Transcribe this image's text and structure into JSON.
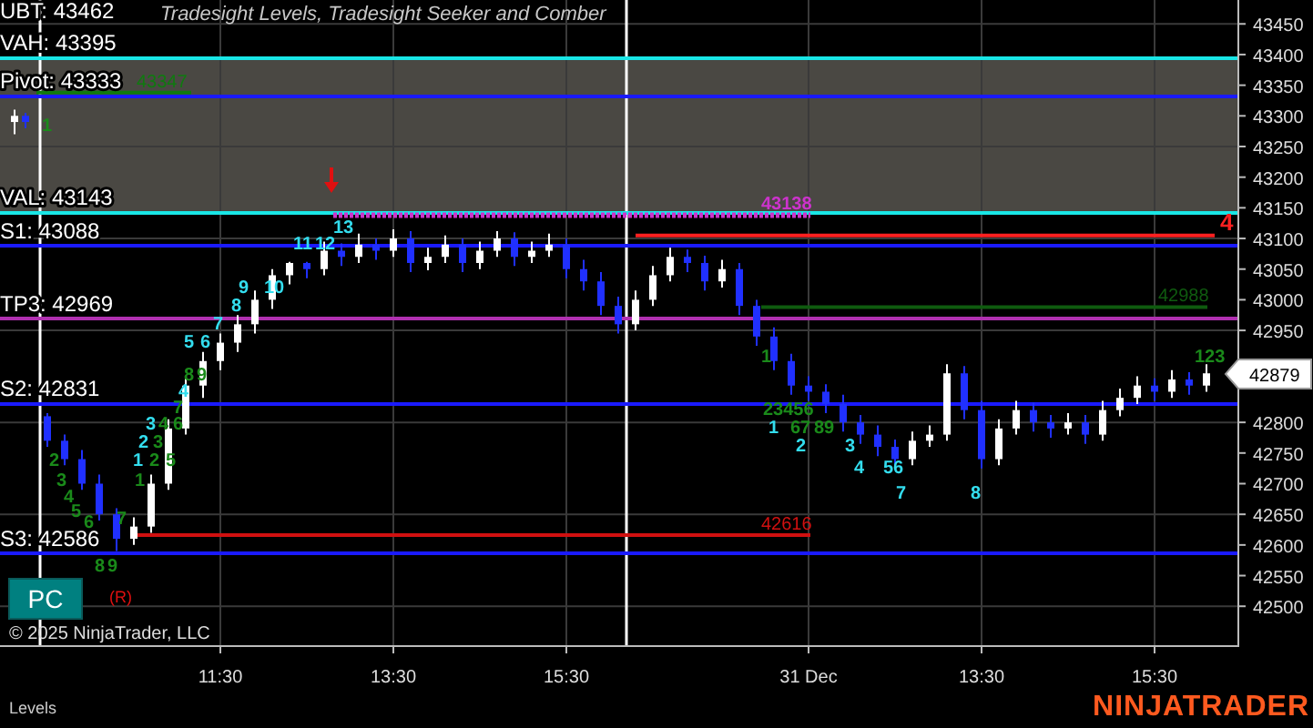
{
  "chart": {
    "legend": "Tradesight Levels, Tradesight Seeker and Comber",
    "header_label": "UBT: 43462",
    "markers": [
      {
        "label": "43347",
        "color": "#0f7a0f",
        "kind": "solid"
      },
      {
        "label": "43138",
        "color": "#cc33cc",
        "kind": "dashed"
      },
      {
        "label": "42988",
        "color": "#0f5a0f",
        "kind": "solid"
      },
      {
        "label": "42616",
        "color": "#d01010",
        "kind": "solid"
      },
      {
        "label": "4",
        "color": "#ff2020",
        "kind": "solid"
      }
    ],
    "counts_first_session": [
      {
        "text": "1",
        "color": "#1a8a1a"
      },
      {
        "text": "13",
        "color": "#33ddee"
      },
      {
        "text": "11",
        "color": "#33ddee"
      },
      {
        "text": "12",
        "color": "#33ddee"
      },
      {
        "text": "9",
        "color": "#33ddee"
      },
      {
        "text": "10",
        "color": "#33ddee"
      },
      {
        "text": "8",
        "color": "#33ddee"
      },
      {
        "text": "7",
        "color": "#33ddee"
      },
      {
        "text": "5",
        "color": "#33ddee"
      },
      {
        "text": "6",
        "color": "#33ddee"
      },
      {
        "text": "8",
        "color": "#1a8a1a"
      },
      {
        "text": "9",
        "color": "#1a8a1a"
      },
      {
        "text": "4",
        "color": "#33ddee"
      },
      {
        "text": "7",
        "color": "#1a8a1a"
      },
      {
        "text": "3",
        "color": "#33ddee"
      },
      {
        "text": "4",
        "color": "#1a8a1a"
      },
      {
        "text": "6",
        "color": "#1a8a1a"
      },
      {
        "text": "2",
        "color": "#33ddee"
      },
      {
        "text": "3",
        "color": "#1a8a1a"
      },
      {
        "text": "2",
        "color": "#1a8a1a"
      },
      {
        "text": "1",
        "color": "#33ddee"
      },
      {
        "text": "2",
        "color": "#1a8a1a"
      },
      {
        "text": "5",
        "color": "#1a8a1a"
      },
      {
        "text": "3",
        "color": "#1a8a1a"
      },
      {
        "text": "1",
        "color": "#1a8a1a"
      },
      {
        "text": "4",
        "color": "#1a8a1a"
      },
      {
        "text": "5",
        "color": "#1a8a1a"
      },
      {
        "text": "6",
        "color": "#1a8a1a"
      },
      {
        "text": "7",
        "color": "#1a8a1a"
      },
      {
        "text": "8",
        "color": "#1a8a1a"
      },
      {
        "text": "9",
        "color": "#1a8a1a"
      }
    ],
    "counts_second_session": [
      {
        "text": "1",
        "color": "#1a8a1a"
      },
      {
        "text": "123",
        "color": "#1a8a1a"
      },
      {
        "text": "23456",
        "color": "#1a8a1a"
      },
      {
        "text": "1",
        "color": "#33ddee"
      },
      {
        "text": "67",
        "color": "#1a8a1a"
      },
      {
        "text": "89",
        "color": "#1a8a1a"
      },
      {
        "text": "2",
        "color": "#33ddee"
      },
      {
        "text": "3",
        "color": "#33ddee"
      },
      {
        "text": "4",
        "color": "#33ddee"
      },
      {
        "text": "56",
        "color": "#33ddee"
      },
      {
        "text": "7",
        "color": "#33ddee"
      },
      {
        "text": "8",
        "color": "#33ddee"
      }
    ],
    "levels": [
      {
        "label": "VAH: 43395",
        "color": "#19e6e6"
      },
      {
        "label": "Pivot: 43333",
        "color": "#1a1aff"
      },
      {
        "label": "VAL: 43143",
        "color": "#19e6e6"
      },
      {
        "label": "S1: 43088",
        "color": "#1a1aff"
      },
      {
        "label": "TP3: 42969",
        "color": "#b030b0"
      },
      {
        "label": "S2: 42831",
        "color": "#1a1aff"
      },
      {
        "label": "S3: 42586",
        "color": "#1a1aff"
      }
    ],
    "chart_data": {
      "type": "candlestick",
      "grid": true,
      "categories": [
        null,
        null,
        null,
        null,
        null,
        null,
        null,
        null,
        null,
        null,
        null,
        null,
        "11:30",
        null,
        null,
        null,
        null,
        null,
        null,
        null,
        null,
        null,
        "13:30",
        null,
        null,
        null,
        null,
        null,
        null,
        null,
        null,
        null,
        "15:30",
        null,
        null,
        null,
        null,
        null,
        null,
        null,
        null,
        null,
        null,
        null,
        null,
        null,
        "31 Dec",
        null,
        null,
        null,
        null,
        null,
        null,
        null,
        null,
        null,
        "13:30",
        null,
        null,
        null,
        null,
        null,
        null,
        null,
        null,
        null,
        "15:30",
        null,
        null,
        null
      ],
      "ohlc": [
        [
          43290,
          43310,
          43270,
          43300
        ],
        [
          43300,
          43305,
          43280,
          43290
        ],
        [
          42810,
          42815,
          42760,
          42770
        ],
        [
          42770,
          42780,
          42730,
          42740
        ],
        [
          42740,
          42755,
          42690,
          42700
        ],
        [
          42700,
          42715,
          42640,
          42650
        ],
        [
          42650,
          42660,
          42590,
          42610
        ],
        [
          42610,
          42645,
          42600,
          42630
        ],
        [
          42630,
          42715,
          42620,
          42700
        ],
        [
          42700,
          42805,
          42690,
          42790
        ],
        [
          42790,
          42875,
          42780,
          42860
        ],
        [
          42860,
          42915,
          42840,
          42900
        ],
        [
          42900,
          42945,
          42885,
          42930
        ],
        [
          42930,
          42975,
          42915,
          42960
        ],
        [
          42960,
          43015,
          42945,
          43000
        ],
        [
          43000,
          43050,
          42985,
          43040
        ],
        [
          43040,
          43062,
          43025,
          43060
        ],
        [
          43060,
          43062,
          43035,
          43050
        ],
        [
          43050,
          43095,
          43040,
          43080
        ],
        [
          43080,
          43092,
          43055,
          43070
        ],
        [
          43070,
          43108,
          43060,
          43090
        ],
        [
          43090,
          43100,
          43065,
          43080
        ],
        [
          43080,
          43115,
          43070,
          43100
        ],
        [
          43100,
          43112,
          43045,
          43060
        ],
        [
          43060,
          43085,
          43048,
          43070
        ],
        [
          43070,
          43105,
          43060,
          43090
        ],
        [
          43090,
          43100,
          43045,
          43060
        ],
        [
          43060,
          43095,
          43050,
          43080
        ],
        [
          43080,
          43112,
          43070,
          43100
        ],
        [
          43100,
          43110,
          43055,
          43070
        ],
        [
          43070,
          43095,
          43060,
          43080
        ],
        [
          43080,
          43108,
          43070,
          43090
        ],
        [
          43090,
          43100,
          43035,
          43050
        ],
        [
          43050,
          43065,
          43015,
          43030
        ],
        [
          43030,
          43045,
          42975,
          42990
        ],
        [
          42990,
          43005,
          42945,
          42960
        ],
        [
          42960,
          43015,
          42950,
          43000
        ],
        [
          43000,
          43055,
          42990,
          43040
        ],
        [
          43040,
          43085,
          43030,
          43070
        ],
        [
          43070,
          43082,
          43045,
          43060
        ],
        [
          43060,
          43072,
          43015,
          43030
        ],
        [
          43030,
          43065,
          43020,
          43050
        ],
        [
          43050,
          43060,
          42975,
          42990
        ],
        [
          42990,
          43000,
          42925,
          42940
        ],
        [
          42940,
          42955,
          42885,
          42900
        ],
        [
          42900,
          42912,
          42845,
          42860
        ],
        [
          42860,
          42875,
          42835,
          42850
        ],
        [
          42850,
          42862,
          42815,
          42830
        ],
        [
          42830,
          42845,
          42785,
          42800
        ],
        [
          42800,
          42812,
          42765,
          42780
        ],
        [
          42780,
          42795,
          42745,
          42760
        ],
        [
          42760,
          42772,
          42725,
          42740
        ],
        [
          42740,
          42785,
          42730,
          42770
        ],
        [
          42770,
          42795,
          42760,
          42780
        ],
        [
          42780,
          42895,
          42770,
          42880
        ],
        [
          42880,
          42892,
          42805,
          42820
        ],
        [
          42820,
          42835,
          42725,
          42740
        ],
        [
          42740,
          42805,
          42730,
          42790
        ],
        [
          42790,
          42835,
          42780,
          42820
        ],
        [
          42820,
          42832,
          42785,
          42800
        ],
        [
          42800,
          42812,
          42775,
          42790
        ],
        [
          42790,
          42815,
          42780,
          42800
        ],
        [
          42800,
          42812,
          42765,
          42780
        ],
        [
          42780,
          42835,
          42770,
          42820
        ],
        [
          42820,
          42855,
          42810,
          42840
        ],
        [
          42840,
          42875,
          42830,
          42860
        ],
        [
          42860,
          42872,
          42835,
          42850
        ],
        [
          42850,
          42885,
          42840,
          42870
        ],
        [
          42870,
          42882,
          42845,
          42860
        ],
        [
          42860,
          42895,
          42850,
          42880
        ]
      ],
      "ylim": [
        42435,
        43489
      ],
      "yticks": [
        43450,
        43400,
        43350,
        43300,
        43250,
        43200,
        43150,
        43100,
        43050,
        43000,
        42950,
        42800,
        42750,
        42700,
        42650,
        42600,
        42550,
        42500
      ]
    },
    "pc_button": "PC",
    "reversal_label": "(R)",
    "last_price": "42879",
    "copyright": "© 2025 NinjaTrader, LLC"
  },
  "footer": {
    "tab": "Levels",
    "logo": "NINJATRADER"
  }
}
